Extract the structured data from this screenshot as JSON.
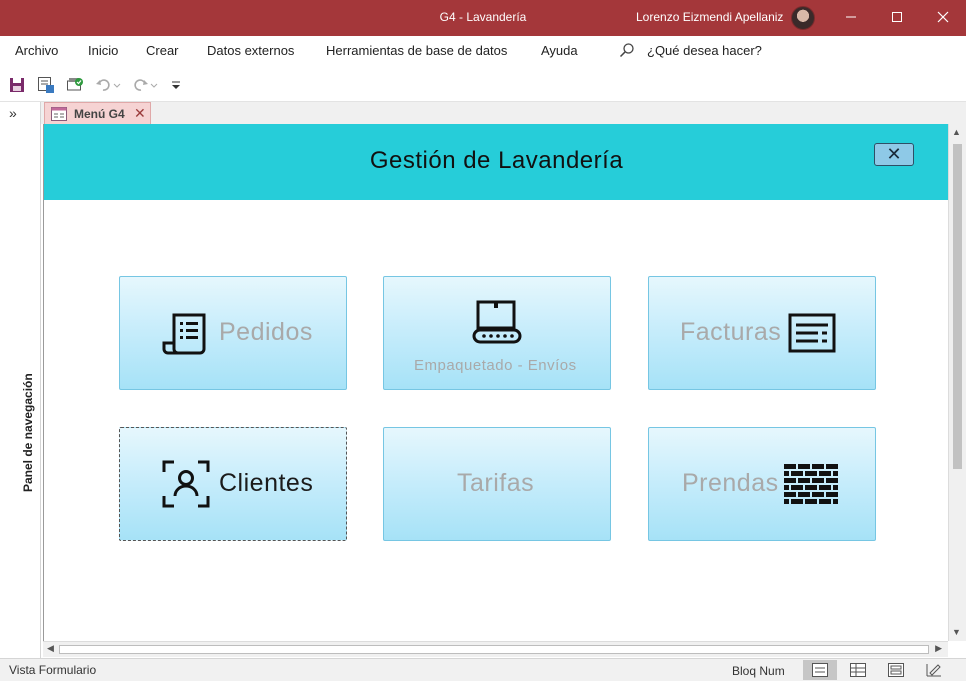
{
  "window": {
    "title": "G4 - Lavandería",
    "user_name": "Lorenzo Eizmendi Apellaniz",
    "minimize_icon": "minimize-icon",
    "maximize_icon": "maximize-icon",
    "close_icon": "close-icon",
    "accent_color": "#a4373a"
  },
  "menu": {
    "items": [
      "Archivo",
      "Inicio",
      "Crear",
      "Datos externos",
      "Herramientas de base de datos",
      "Ayuda"
    ],
    "search_placeholder": "¿Qué desea hacer?"
  },
  "quick_access": {
    "icons": [
      "save-icon",
      "form-view-icon",
      "refresh-all-icon",
      "undo-icon",
      "redo-icon",
      "customize-icon"
    ]
  },
  "nav_pane": {
    "expand_glyph": "»",
    "label": "Panel de navegación"
  },
  "document_tab": {
    "label": "Menú G4",
    "close_glyph": "✕"
  },
  "form": {
    "header_title": "Gestión de Lavandería",
    "header_color": "#26cdd9",
    "close_glyph": "✕",
    "tiles": {
      "pedidos": {
        "label": "Pedidos",
        "icon": "receipt-icon"
      },
      "empaquetado": {
        "label": "Empaquetado - Envíos",
        "icon": "conveyor-box-icon"
      },
      "facturas": {
        "label": "Facturas",
        "icon": "invoice-icon"
      },
      "clientes": {
        "label": "Clientes",
        "icon": "user-frame-icon"
      },
      "tarifas": {
        "label": "Tarifas"
      },
      "prendas": {
        "label": "Prendas",
        "icon": "fabric-icon"
      }
    }
  },
  "status_bar": {
    "left_text": "Vista Formulario",
    "num_lock": "Bloq Num",
    "view_icons": [
      "form-view-icon",
      "datasheet-view-icon",
      "layout-view-icon",
      "design-view-icon"
    ]
  }
}
